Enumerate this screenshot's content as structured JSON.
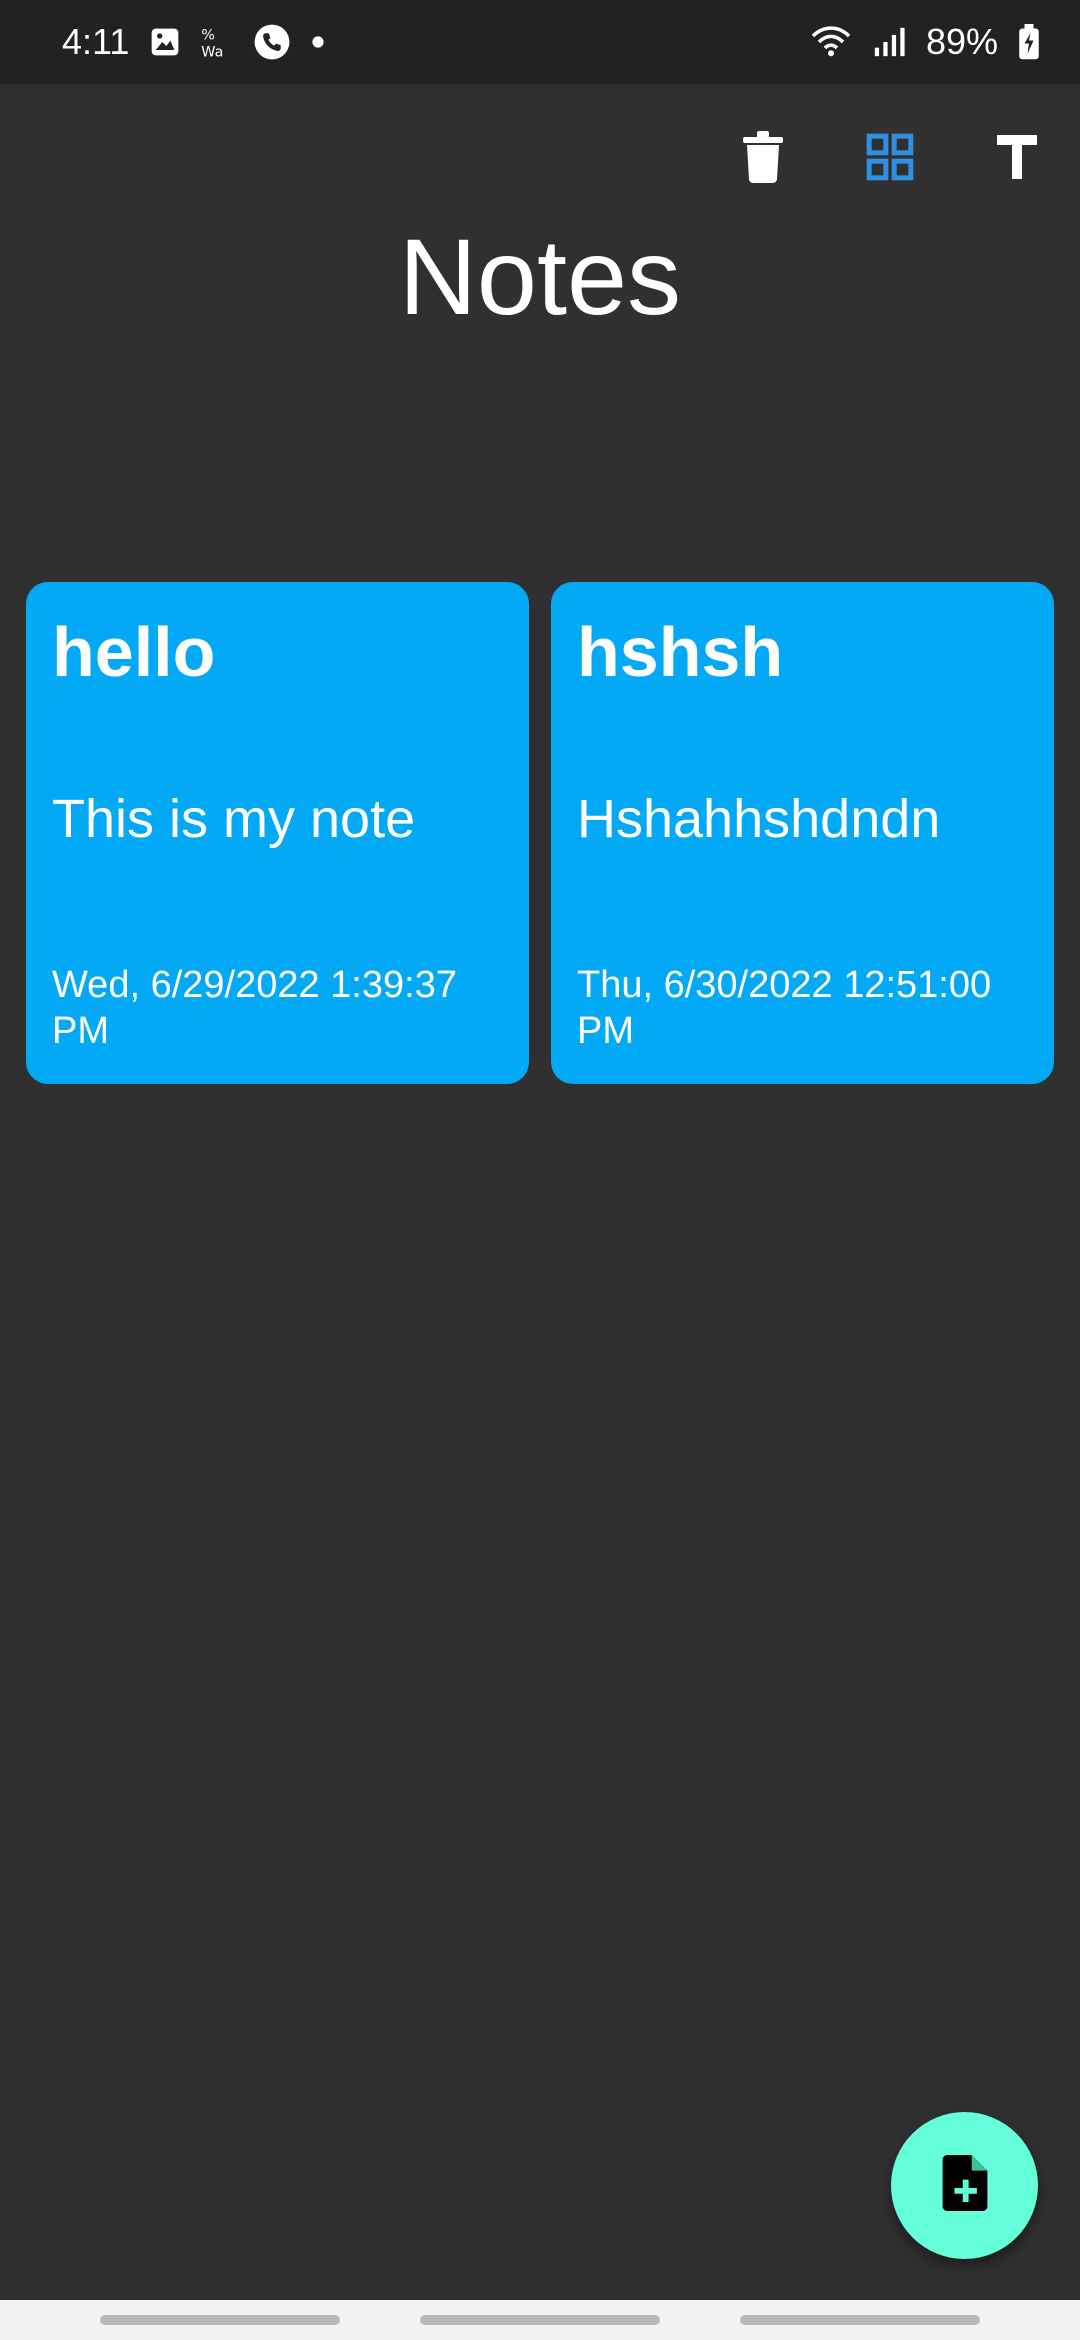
{
  "status_bar": {
    "time": "4:11",
    "battery": "89%",
    "left_icons": [
      "image-icon",
      "wa-status-icon",
      "phone-call-icon",
      "dot-icon"
    ],
    "right_icons": [
      "wifi-icon",
      "signal-icon",
      "battery-charging-icon"
    ]
  },
  "toolbar": {
    "icons": [
      "trash-icon",
      "grid-view-icon",
      "text-format-icon"
    ],
    "accent_color": "#2f8fe0"
  },
  "page": {
    "title": "Notes"
  },
  "notes": [
    {
      "title": "hello",
      "body": "This is my note",
      "date": "Wed, 6/29/2022 1:39:37 PM"
    },
    {
      "title": "hshsh",
      "body": "Hshahhshdndn",
      "date": "Thu, 6/30/2022 12:51:00 PM"
    }
  ],
  "fab": {
    "icon": "add-note-icon",
    "color": "#64ffda"
  },
  "colors": {
    "background": "#303030",
    "card": "#03a9f4",
    "status_bar": "#222222"
  }
}
